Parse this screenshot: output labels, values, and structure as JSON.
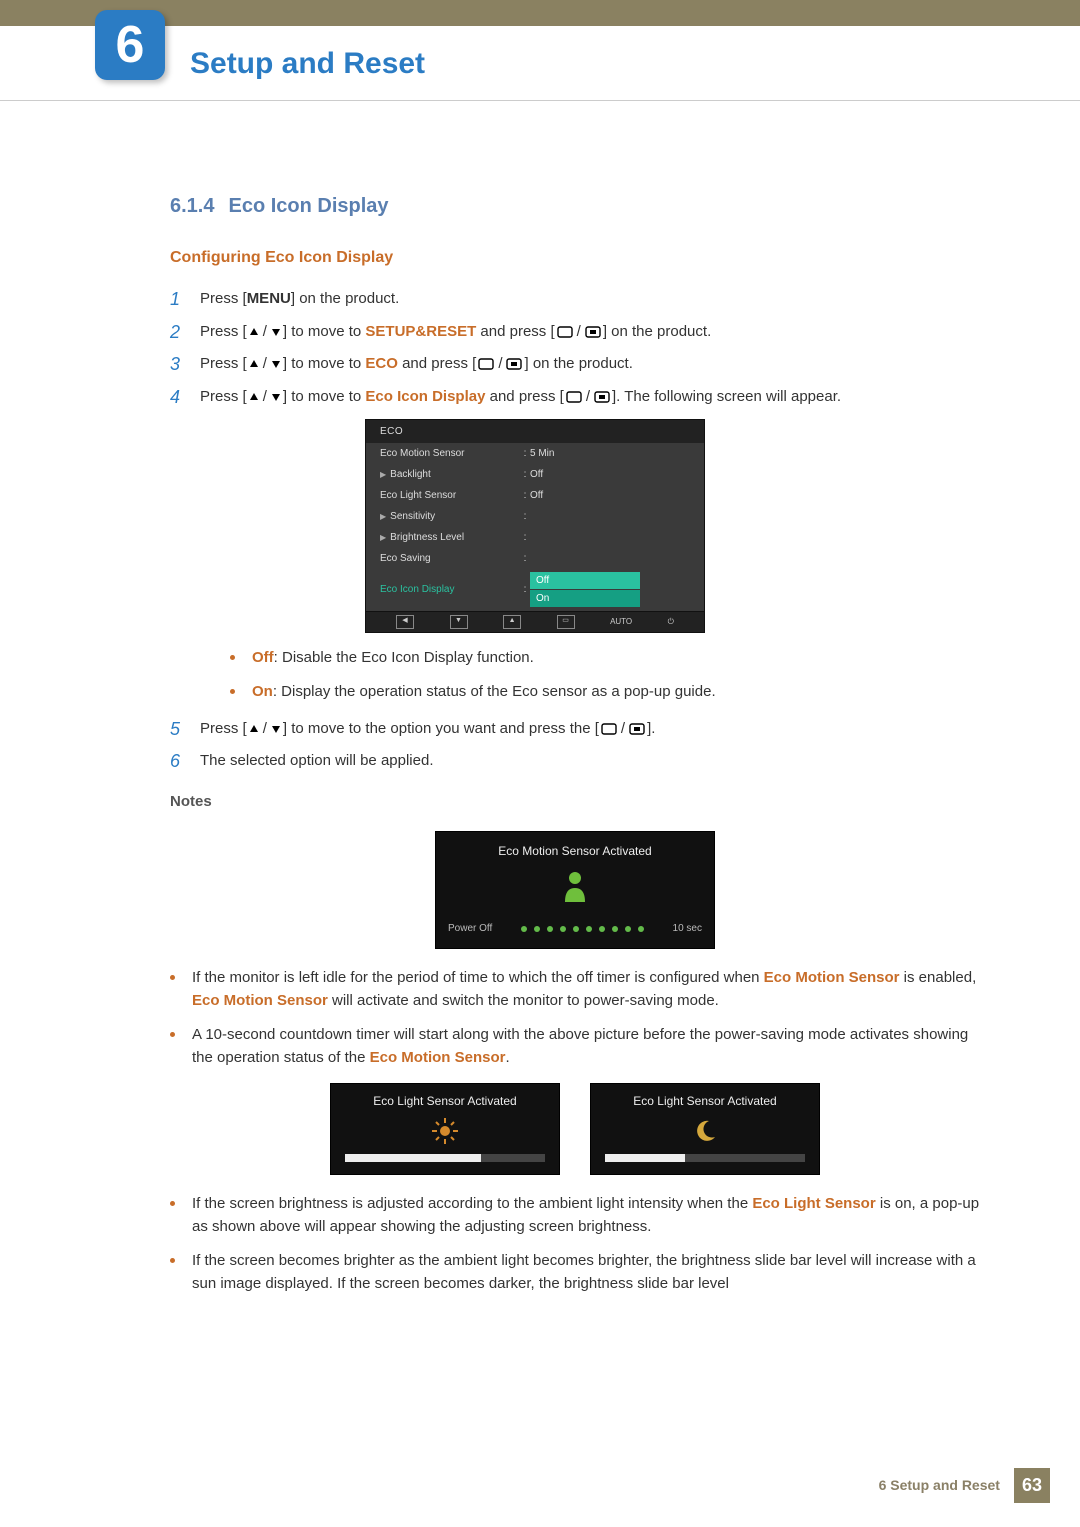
{
  "chapter": {
    "number": "6",
    "title": "Setup and Reset"
  },
  "section": {
    "number": "6.1.4",
    "title": "Eco Icon Display"
  },
  "subsection": "Configuring Eco Icon Display",
  "steps": {
    "s1_a": "Press [",
    "s1_menu": "MENU",
    "s1_b": "] on the product.",
    "s2_a": "Press [",
    "s2_b": "] to move to ",
    "s2_target": "SETUP&RESET",
    "s2_c": " and press [",
    "s2_d": "] on the product.",
    "s3_a": "Press [",
    "s3_b": "] to move to ",
    "s3_target": "ECO",
    "s3_c": " and press [",
    "s3_d": "] on the product.",
    "s4_a": "Press [",
    "s4_b": "] to move to ",
    "s4_target": "Eco Icon Display",
    "s4_c": " and press [",
    "s4_d": "]. The following screen will appear.",
    "s5_a": "Press [",
    "s5_b": "] to move to the option you want and press the [",
    "s5_c": "].",
    "s6": "The selected option will be applied."
  },
  "osd": {
    "title": "ECO",
    "rows": [
      {
        "label": "Eco Motion Sensor",
        "value": "5 Min"
      },
      {
        "label": "Backlight",
        "value": "Off",
        "indent": true
      },
      {
        "label": "Eco Light Sensor",
        "value": "Off"
      },
      {
        "label": "Sensitivity",
        "value": "",
        "indent": true
      },
      {
        "label": "Brightness Level",
        "value": "",
        "indent": true
      },
      {
        "label": "Eco Saving",
        "value": ""
      },
      {
        "label": "Eco Icon Display",
        "value": "",
        "active": true
      }
    ],
    "dropdown": [
      "Off",
      "On"
    ],
    "footer_auto": "AUTO"
  },
  "option_bullets": {
    "off_label": "Off",
    "off_text": ": Disable the Eco Icon Display function.",
    "on_label": "On",
    "on_text": ": Display the operation status of the Eco sensor as a pop-up guide."
  },
  "notes_title": "Notes",
  "popup_motion": {
    "title": "Eco Motion Sensor Activated",
    "power_off": "Power Off",
    "secs": "10 sec"
  },
  "notes": {
    "n1a": "If the monitor is left idle for the period of time to which the off timer is configured when ",
    "n1b": "Eco Motion Sensor",
    "n1c": " is enabled, ",
    "n1d": "Eco Motion Sensor",
    "n1e": " will activate and switch the monitor to power-saving mode.",
    "n2a": "A 10-second countdown timer will start along with the above picture before the power-saving mode activates showing the operation status of the ",
    "n2b": "Eco Motion Sensor",
    "n2c": ".",
    "n3a": "If the screen brightness is adjusted according to the ambient light intensity when the ",
    "n3b": "Eco Light Sensor",
    "n3c": " is on, a pop-up as shown above will appear showing the adjusting screen brightness.",
    "n4": "If the screen becomes brighter as the ambient light becomes brighter, the brightness slide bar level will increase with a sun image displayed. If the screen becomes darker, the brightness slide bar level"
  },
  "popup_light": {
    "title1": "Eco Light Sensor Activated",
    "title2": "Eco Light Sensor Activated"
  },
  "footer": {
    "chapter": "6",
    "title": "Setup and Reset",
    "page": "63"
  }
}
